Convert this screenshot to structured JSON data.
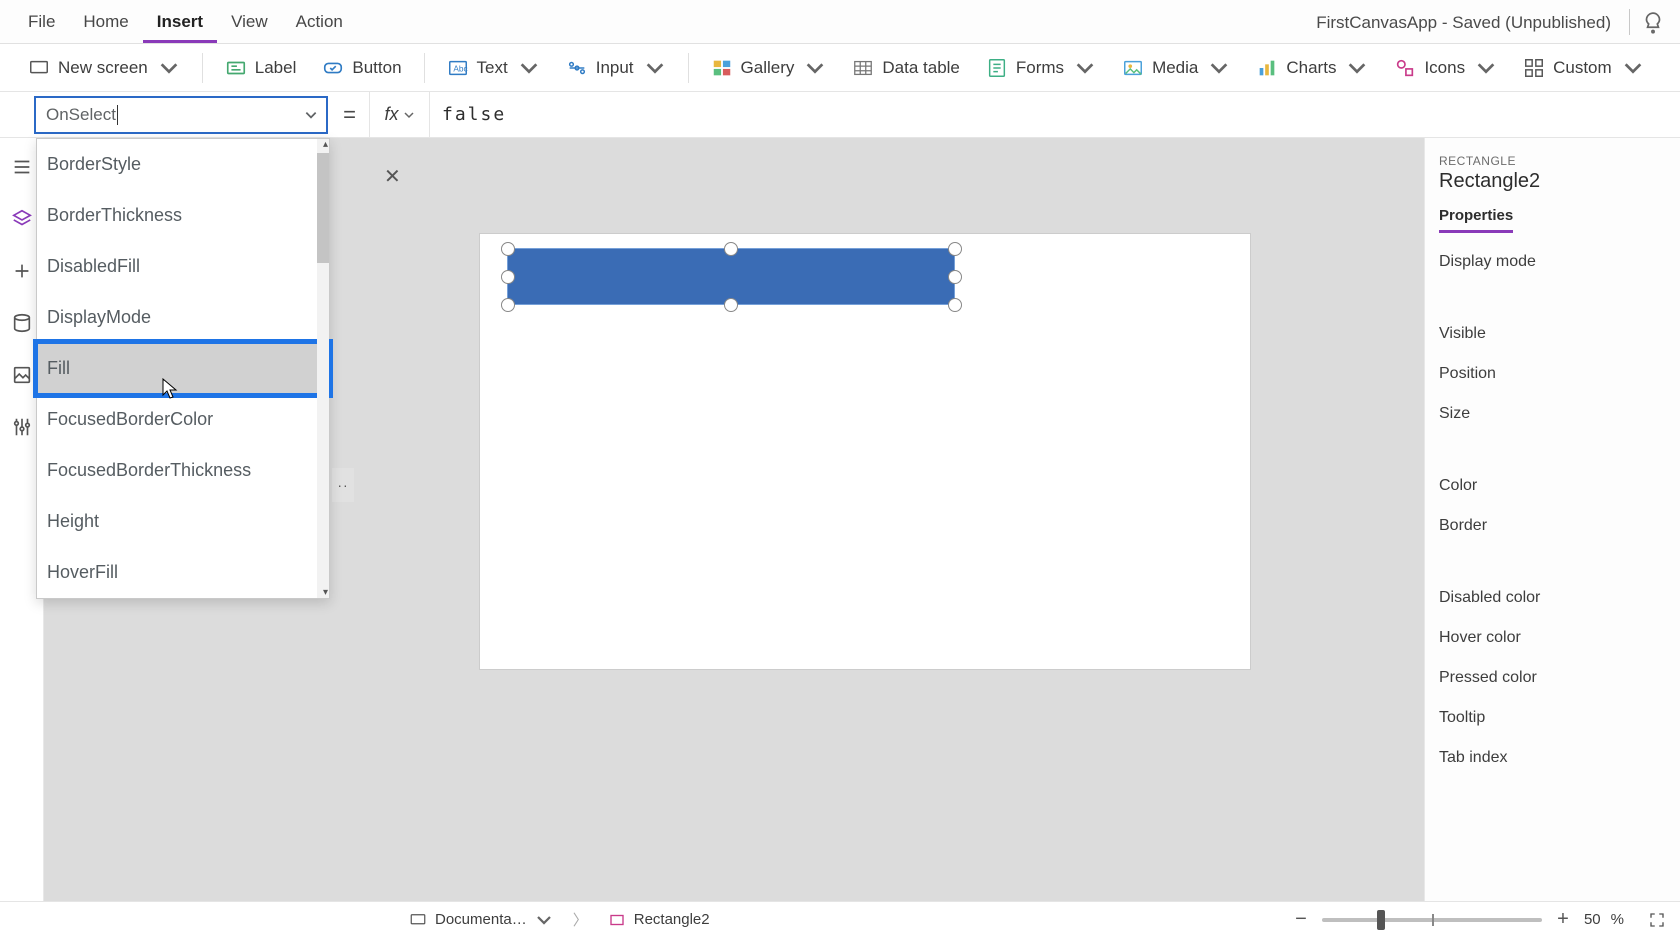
{
  "app_title": "FirstCanvasApp - Saved (Unpublished)",
  "menubar": {
    "tabs": [
      "File",
      "Home",
      "Insert",
      "View",
      "Action"
    ],
    "active_index": 2
  },
  "ribbon": {
    "new_screen": "New screen",
    "label": "Label",
    "button": "Button",
    "text": "Text",
    "input": "Input",
    "gallery": "Gallery",
    "data_table": "Data table",
    "forms": "Forms",
    "media": "Media",
    "charts": "Charts",
    "icons": "Icons",
    "custom": "Custom"
  },
  "formula": {
    "property": "OnSelect",
    "equals": "=",
    "fx": "fx",
    "value": "false"
  },
  "dropdown": {
    "items": [
      "BorderStyle",
      "BorderThickness",
      "DisabledFill",
      "DisplayMode",
      "Fill",
      "FocusedBorderColor",
      "FocusedBorderThickness",
      "Height",
      "HoverFill"
    ],
    "highlighted_index": 4
  },
  "selection": {
    "type_label": "RECTANGLE",
    "name": "Rectangle2"
  },
  "properties_pane": {
    "tab": "Properties",
    "rows": [
      "Display mode",
      "Visible",
      "Position",
      "Size",
      "Color",
      "Border",
      "Disabled color",
      "Hover color",
      "Pressed color",
      "Tooltip",
      "Tab index"
    ]
  },
  "statusbar": {
    "screen_crumb": "Documenta…",
    "selection_crumb": "Rectangle2",
    "zoom_percent": "50",
    "zoom_unit": "%"
  }
}
